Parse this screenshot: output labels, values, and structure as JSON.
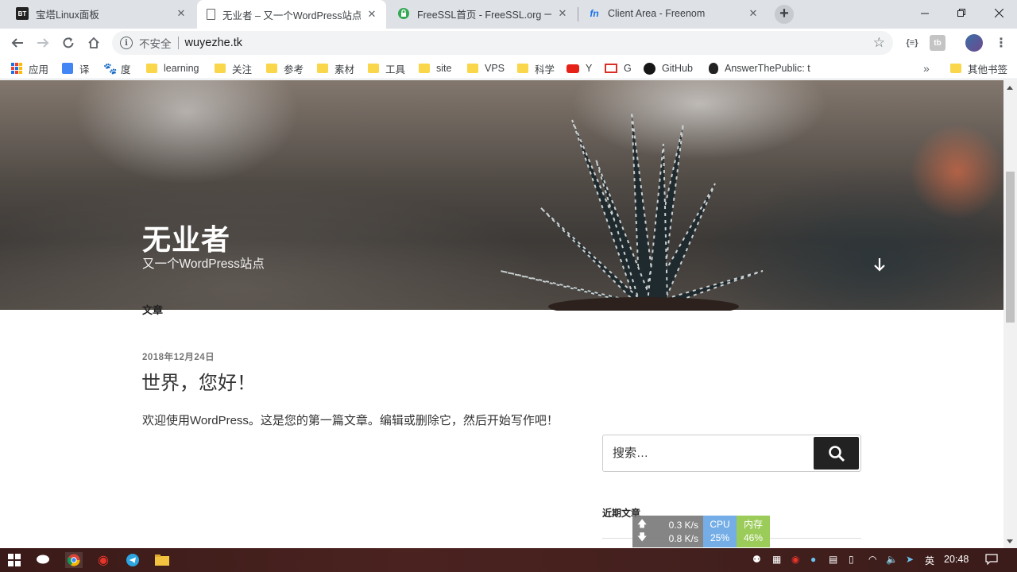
{
  "browser": {
    "tabs": [
      {
        "title": "宝塔Linux面板",
        "favicon": "bt-icon",
        "active": false
      },
      {
        "title": "无业者 – 又一个WordPress站点",
        "favicon": "page-icon",
        "active": true
      },
      {
        "title": "FreeSSL首页 - FreeSSL.org 一个",
        "favicon": "lock-icon",
        "active": false
      },
      {
        "title": "Client Area - Freenom",
        "favicon": "freenom-icon",
        "active": false
      }
    ],
    "omnibox": {
      "security_label": "不安全",
      "url": "wuyezhe.tk"
    },
    "bookmarks": [
      {
        "label": "应用",
        "icon": "apps-grid-icon"
      },
      {
        "label": "译",
        "icon": "translate-icon"
      },
      {
        "label": "度",
        "icon": "baidu-icon"
      },
      {
        "label": "learning",
        "icon": "folder-icon"
      },
      {
        "label": "关注",
        "icon": "folder-icon"
      },
      {
        "label": "参考",
        "icon": "folder-icon"
      },
      {
        "label": "素材",
        "icon": "folder-icon"
      },
      {
        "label": "工具",
        "icon": "folder-icon"
      },
      {
        "label": "site",
        "icon": "folder-icon"
      },
      {
        "label": "VPS",
        "icon": "folder-icon"
      },
      {
        "label": "科学",
        "icon": "folder-icon"
      },
      {
        "label": "Y",
        "icon": "youtube-icon"
      },
      {
        "label": "G",
        "icon": "gmail-icon"
      },
      {
        "label": "GitHub",
        "icon": "github-icon"
      },
      {
        "label": "AnswerThePublic: t",
        "icon": "answerthepublic-icon"
      },
      {
        "label": "其他书签",
        "icon": "folder-icon"
      }
    ],
    "overflow_label": "»"
  },
  "site": {
    "title": "无业者",
    "description": "又一个WordPress站点",
    "section_label": "文章",
    "post": {
      "date": "2018年12月24日",
      "title": "世界，您好！",
      "excerpt": "欢迎使用WordPress。这是您的第一篇文章。编辑或删除它，然后开始写作吧！"
    },
    "search": {
      "placeholder": "搜索…"
    },
    "widget_title": "近期文章"
  },
  "netmon": {
    "up": "0.3 K/s",
    "down": "0.8 K/s",
    "cpu_label": "CPU",
    "cpu_value": "25%",
    "mem_label": "内存",
    "mem_value": "46%"
  },
  "taskbar": {
    "ime": "英",
    "time": "20:48"
  },
  "colors": {
    "accent": "#1a73e8",
    "search_button": "#222222",
    "cpu": "#6eaae6",
    "mem": "#96c850"
  }
}
